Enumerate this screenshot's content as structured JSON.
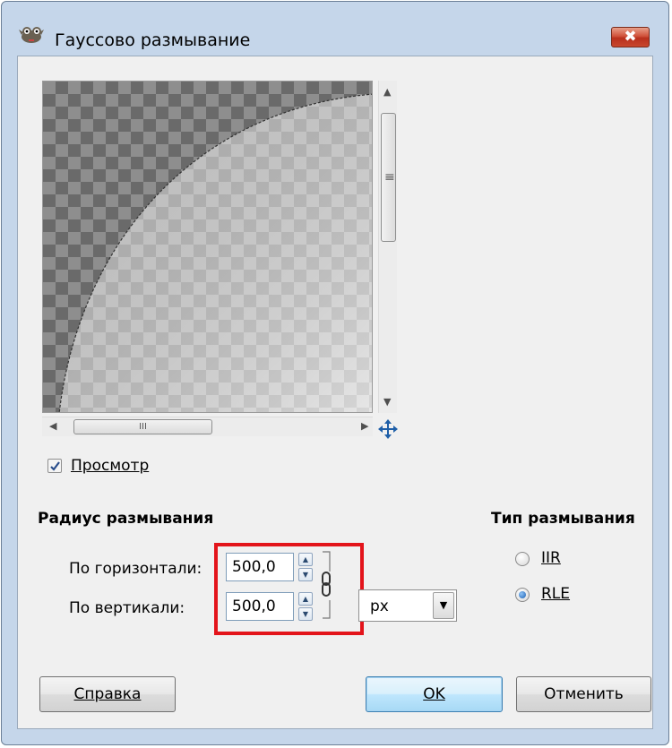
{
  "window": {
    "title": "Гауссово размывание",
    "close_glyph": "✖"
  },
  "preview": {
    "hscroll_grip": "III",
    "vscroll_grip": "≡",
    "checkbox_label": "Просмотр",
    "checkbox_checked": true
  },
  "blur_radius": {
    "heading": "Радиус размывания",
    "horizontal_label": "По горизонтали:",
    "horizontal_value": "500,0",
    "vertical_label": "По вертикали:",
    "vertical_value": "500,0",
    "unit": "px"
  },
  "blur_type": {
    "heading": "Тип размывания",
    "options": [
      {
        "label": "IIR",
        "selected": false
      },
      {
        "label": "RLE",
        "selected": true
      }
    ]
  },
  "buttons": {
    "help": "Справка",
    "ok": "OK",
    "cancel": "Отменить"
  },
  "colors": {
    "highlight": "#e3141b",
    "window_frame": "#c5d6ea",
    "dialog_bg": "#f0f0f0"
  }
}
